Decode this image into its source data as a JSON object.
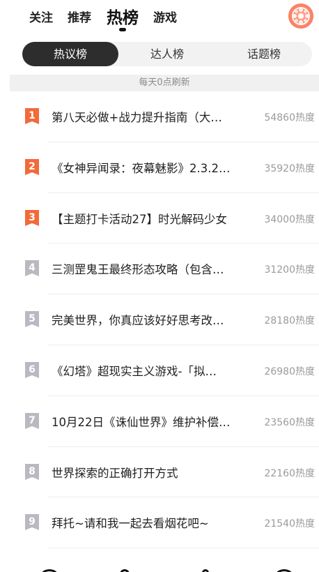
{
  "nav": {
    "tabs": [
      "关注",
      "推荐",
      "热榜",
      "游戏"
    ],
    "active_tab": "热榜"
  },
  "segments": {
    "items": [
      "热议榜",
      "达人榜",
      "话题榜"
    ],
    "active": "热议榜"
  },
  "refresh_note": "每天0点刷新",
  "list": [
    {
      "rank": "1",
      "title": "第八天必做+战力提升指南（大…",
      "heat": "54860热度"
    },
    {
      "rank": "2",
      "title": "《女神异闻录：夜幕魅影》2.3.2…",
      "heat": "35920热度"
    },
    {
      "rank": "3",
      "title": "【主题打卡活动27】时光解码少女",
      "heat": "34000热度"
    },
    {
      "rank": "4",
      "title": "三测罡鬼王最终形态攻略（包含…",
      "heat": "31200热度"
    },
    {
      "rank": "5",
      "title": "完美世界，你真应该好好思考改…",
      "heat": "28180热度"
    },
    {
      "rank": "6",
      "title": "《幻塔》超现实主义游戏-「拟…",
      "heat": "26980热度"
    },
    {
      "rank": "7",
      "title": "10月22日《诛仙世界》维护补偿…",
      "heat": "23560热度"
    },
    {
      "rank": "8",
      "title": "世界探索的正确打开方式",
      "heat": "22160热度"
    },
    {
      "rank": "9",
      "title": "拜托~请和我一起去看烟花吧~",
      "heat": "21540热度"
    }
  ],
  "colors": {
    "rank_top": "#f36a3a",
    "rank_other": "#b9b9c2",
    "avatar": "#ff8a6c"
  }
}
